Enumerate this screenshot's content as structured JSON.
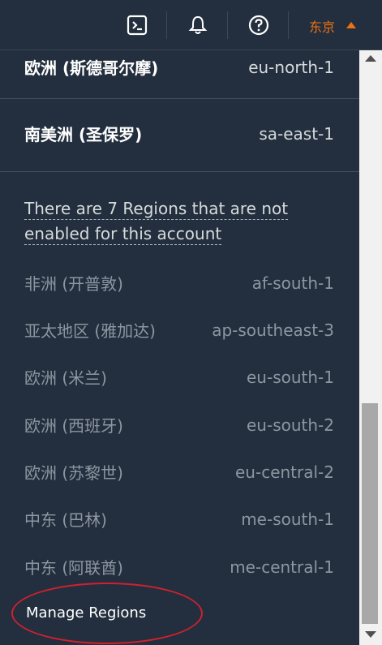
{
  "topbar": {
    "icons": [
      "cloudshell-icon",
      "bell-icon",
      "help-icon"
    ],
    "region_selector": "东京"
  },
  "enabled_regions": [
    {
      "name": "欧洲 (斯德哥尔摩)",
      "code": "eu-north-1"
    },
    {
      "name": "南美洲 (圣保罗)",
      "code": "sa-east-1"
    }
  ],
  "notice": {
    "line1": "There are 7 Regions that are not",
    "line2": "enabled for this account"
  },
  "disabled_regions": [
    {
      "name": "非洲 (开普敦)",
      "code": "af-south-1"
    },
    {
      "name": "亚太地区 (雅加达)",
      "code": "ap-southeast-3"
    },
    {
      "name": "欧洲 (米兰)",
      "code": "eu-south-1"
    },
    {
      "name": "欧洲 (西班牙)",
      "code": "eu-south-2"
    },
    {
      "name": "欧洲 (苏黎世)",
      "code": "eu-central-2"
    },
    {
      "name": "中东 (巴林)",
      "code": "me-south-1"
    },
    {
      "name": "中东 (阿联酋)",
      "code": "me-central-1"
    }
  ],
  "manage_regions": "Manage Regions",
  "colors": {
    "background": "#232f3e",
    "accent": "#ec7211",
    "annotation": "#d0202f"
  }
}
